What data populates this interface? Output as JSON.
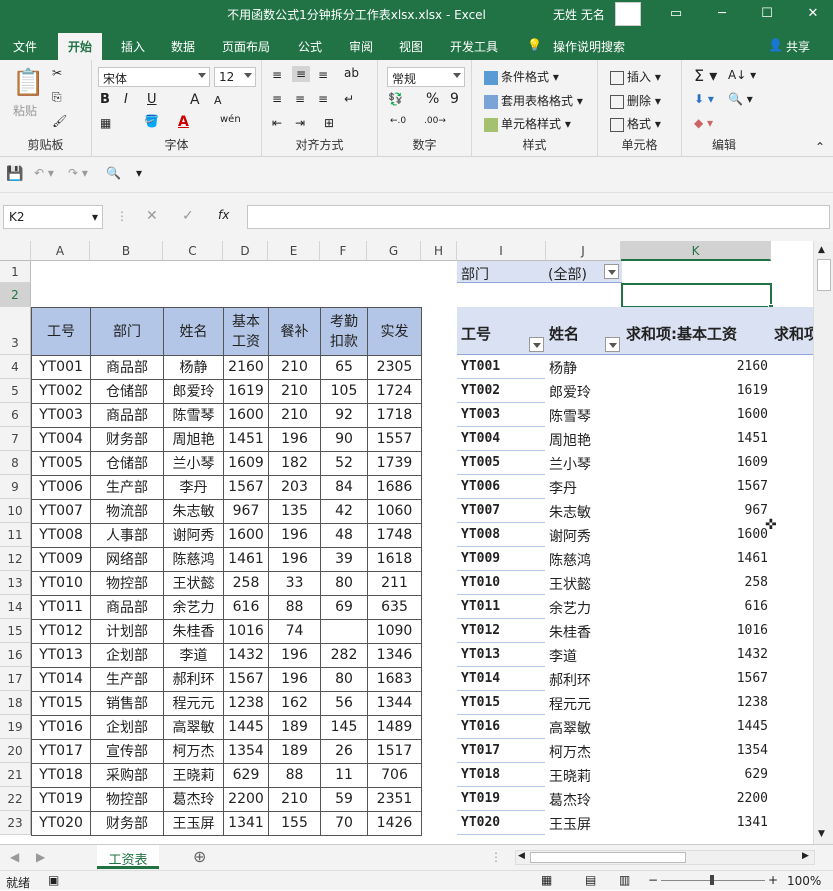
{
  "window": {
    "title": "不用函数公式1分钟拆分工作表xlsx.xlsx  -  Excel",
    "user": "无姓 无名"
  },
  "tabs": [
    "文件",
    "开始",
    "插入",
    "数据",
    "页面布局",
    "公式",
    "审阅",
    "视图",
    "开发工具",
    "操作说明搜索",
    "共享"
  ],
  "ribbon": {
    "clipboard": {
      "paste": "粘贴",
      "label": "剪贴板"
    },
    "font": {
      "name": "宋体",
      "size": "12",
      "bold": "B",
      "italic": "I",
      "underline": "U",
      "grow": "A",
      "shrink": "A",
      "wen": "wén",
      "fontcolor": "A",
      "label": "字体"
    },
    "align": {
      "label": "对齐方式"
    },
    "number": {
      "format": "常规",
      "percent": "%",
      "comma": "9",
      "label": "数字"
    },
    "styles": {
      "cond": "条件格式",
      "table": "套用表格格式",
      "cell": "单元格样式",
      "label": "样式"
    },
    "cells": {
      "insert": "插入",
      "delete": "删除",
      "format": "格式",
      "label": "单元格"
    },
    "editing": {
      "label": "编辑"
    }
  },
  "formula_bar": {
    "name_box": "K2",
    "fx": "fx",
    "value": ""
  },
  "columns": [
    "A",
    "B",
    "C",
    "D",
    "E",
    "F",
    "G",
    "H",
    "I",
    "J",
    "K"
  ],
  "rows": [
    "1",
    "2",
    "3",
    "4",
    "5",
    "6",
    "7",
    "8",
    "9",
    "10",
    "11",
    "12",
    "13",
    "14",
    "15",
    "16",
    "17",
    "18",
    "19",
    "20",
    "21",
    "22",
    "23"
  ],
  "table": {
    "headers": [
      "工号",
      "部门",
      "姓名",
      "基本\n工资",
      "餐补",
      "考勤\n扣款",
      "实发"
    ],
    "rows": [
      [
        "YT001",
        "商品部",
        "杨静",
        "2160",
        "210",
        "65",
        "2305"
      ],
      [
        "YT002",
        "仓储部",
        "郎爱玲",
        "1619",
        "210",
        "105",
        "1724"
      ],
      [
        "YT003",
        "商品部",
        "陈雪琴",
        "1600",
        "210",
        "92",
        "1718"
      ],
      [
        "YT004",
        "财务部",
        "周旭艳",
        "1451",
        "196",
        "90",
        "1557"
      ],
      [
        "YT005",
        "仓储部",
        "兰小琴",
        "1609",
        "182",
        "52",
        "1739"
      ],
      [
        "YT006",
        "生产部",
        "李丹",
        "1567",
        "203",
        "84",
        "1686"
      ],
      [
        "YT007",
        "物流部",
        "朱志敏",
        "967",
        "135",
        "42",
        "1060"
      ],
      [
        "YT008",
        "人事部",
        "谢阿秀",
        "1600",
        "196",
        "48",
        "1748"
      ],
      [
        "YT009",
        "网络部",
        "陈慈鸿",
        "1461",
        "196",
        "39",
        "1618"
      ],
      [
        "YT010",
        "物控部",
        "王状懿",
        "258",
        "33",
        "80",
        "211"
      ],
      [
        "YT011",
        "商品部",
        "余艺力",
        "616",
        "88",
        "69",
        "635"
      ],
      [
        "YT012",
        "计划部",
        "朱桂香",
        "1016",
        "74",
        "",
        "1090"
      ],
      [
        "YT013",
        "企划部",
        "李道",
        "1432",
        "196",
        "282",
        "1346"
      ],
      [
        "YT014",
        "生产部",
        "郝利环",
        "1567",
        "196",
        "80",
        "1683"
      ],
      [
        "YT015",
        "销售部",
        "程元元",
        "1238",
        "162",
        "56",
        "1344"
      ],
      [
        "YT016",
        "企划部",
        "高翠敏",
        "1445",
        "189",
        "145",
        "1489"
      ],
      [
        "YT017",
        "宣传部",
        "柯万杰",
        "1354",
        "189",
        "26",
        "1517"
      ],
      [
        "YT018",
        "采购部",
        "王晓莉",
        "629",
        "88",
        "11",
        "706"
      ],
      [
        "YT019",
        "物控部",
        "葛杰玲",
        "2200",
        "210",
        "59",
        "2351"
      ],
      [
        "YT020",
        "财务部",
        "王玉屏",
        "1341",
        "155",
        "70",
        "1426"
      ]
    ]
  },
  "pivot": {
    "filter_label": "部门",
    "filter_value": "(全部)",
    "headers": [
      "工号",
      "姓名",
      "求和项:基本工资",
      "求和项"
    ],
    "rows": [
      [
        "YT001",
        "杨静",
        "2160"
      ],
      [
        "YT002",
        "郎爱玲",
        "1619"
      ],
      [
        "YT003",
        "陈雪琴",
        "1600"
      ],
      [
        "YT004",
        "周旭艳",
        "1451"
      ],
      [
        "YT005",
        "兰小琴",
        "1609"
      ],
      [
        "YT006",
        "李丹",
        "1567"
      ],
      [
        "YT007",
        "朱志敏",
        "967"
      ],
      [
        "YT008",
        "谢阿秀",
        "1600"
      ],
      [
        "YT009",
        "陈慈鸿",
        "1461"
      ],
      [
        "YT010",
        "王状懿",
        "258"
      ],
      [
        "YT011",
        "余艺力",
        "616"
      ],
      [
        "YT012",
        "朱桂香",
        "1016"
      ],
      [
        "YT013",
        "李道",
        "1432"
      ],
      [
        "YT014",
        "郝利环",
        "1567"
      ],
      [
        "YT015",
        "程元元",
        "1238"
      ],
      [
        "YT016",
        "高翠敏",
        "1445"
      ],
      [
        "YT017",
        "柯万杰",
        "1354"
      ],
      [
        "YT018",
        "王晓莉",
        "629"
      ],
      [
        "YT019",
        "葛杰玲",
        "2200"
      ],
      [
        "YT020",
        "王玉屏",
        "1341"
      ]
    ]
  },
  "sheet_tab": "工资表",
  "status": {
    "ready": "就绪",
    "zoom": "100%"
  },
  "colors": {
    "accent": "#217346",
    "header_fill": "#b4c6e7",
    "pivot_fill": "#d9e1f2"
  }
}
